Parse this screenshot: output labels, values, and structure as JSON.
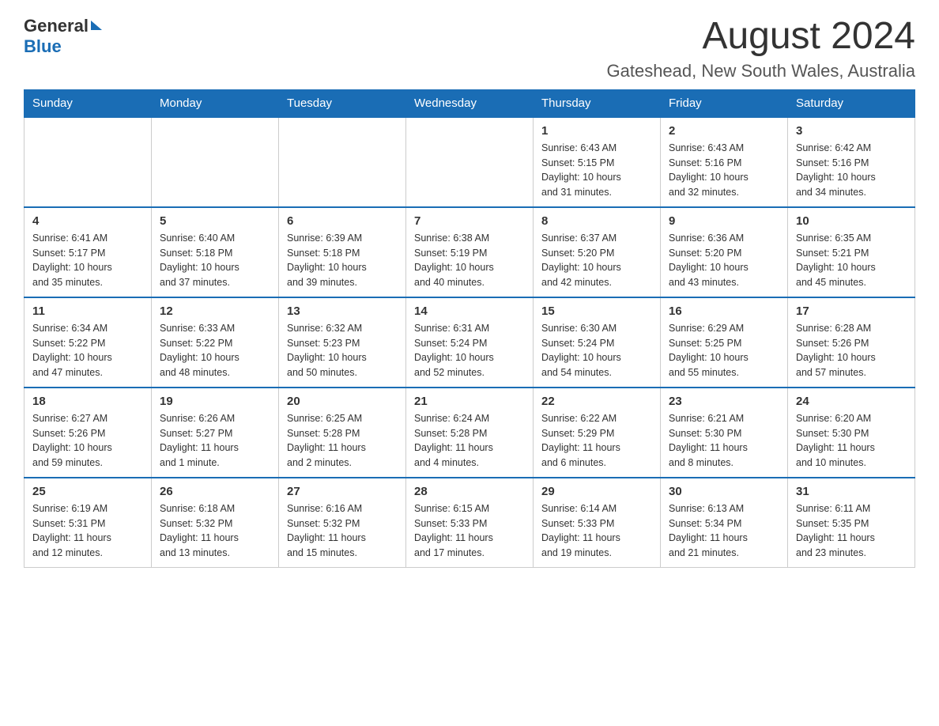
{
  "header": {
    "logo": {
      "general": "General",
      "blue": "Blue"
    },
    "title": "August 2024",
    "location": "Gateshead, New South Wales, Australia"
  },
  "calendar": {
    "weekdays": [
      "Sunday",
      "Monday",
      "Tuesday",
      "Wednesday",
      "Thursday",
      "Friday",
      "Saturday"
    ],
    "weeks": [
      [
        {
          "day": "",
          "info": ""
        },
        {
          "day": "",
          "info": ""
        },
        {
          "day": "",
          "info": ""
        },
        {
          "day": "",
          "info": ""
        },
        {
          "day": "1",
          "info": "Sunrise: 6:43 AM\nSunset: 5:15 PM\nDaylight: 10 hours\nand 31 minutes."
        },
        {
          "day": "2",
          "info": "Sunrise: 6:43 AM\nSunset: 5:16 PM\nDaylight: 10 hours\nand 32 minutes."
        },
        {
          "day": "3",
          "info": "Sunrise: 6:42 AM\nSunset: 5:16 PM\nDaylight: 10 hours\nand 34 minutes."
        }
      ],
      [
        {
          "day": "4",
          "info": "Sunrise: 6:41 AM\nSunset: 5:17 PM\nDaylight: 10 hours\nand 35 minutes."
        },
        {
          "day": "5",
          "info": "Sunrise: 6:40 AM\nSunset: 5:18 PM\nDaylight: 10 hours\nand 37 minutes."
        },
        {
          "day": "6",
          "info": "Sunrise: 6:39 AM\nSunset: 5:18 PM\nDaylight: 10 hours\nand 39 minutes."
        },
        {
          "day": "7",
          "info": "Sunrise: 6:38 AM\nSunset: 5:19 PM\nDaylight: 10 hours\nand 40 minutes."
        },
        {
          "day": "8",
          "info": "Sunrise: 6:37 AM\nSunset: 5:20 PM\nDaylight: 10 hours\nand 42 minutes."
        },
        {
          "day": "9",
          "info": "Sunrise: 6:36 AM\nSunset: 5:20 PM\nDaylight: 10 hours\nand 43 minutes."
        },
        {
          "day": "10",
          "info": "Sunrise: 6:35 AM\nSunset: 5:21 PM\nDaylight: 10 hours\nand 45 minutes."
        }
      ],
      [
        {
          "day": "11",
          "info": "Sunrise: 6:34 AM\nSunset: 5:22 PM\nDaylight: 10 hours\nand 47 minutes."
        },
        {
          "day": "12",
          "info": "Sunrise: 6:33 AM\nSunset: 5:22 PM\nDaylight: 10 hours\nand 48 minutes."
        },
        {
          "day": "13",
          "info": "Sunrise: 6:32 AM\nSunset: 5:23 PM\nDaylight: 10 hours\nand 50 minutes."
        },
        {
          "day": "14",
          "info": "Sunrise: 6:31 AM\nSunset: 5:24 PM\nDaylight: 10 hours\nand 52 minutes."
        },
        {
          "day": "15",
          "info": "Sunrise: 6:30 AM\nSunset: 5:24 PM\nDaylight: 10 hours\nand 54 minutes."
        },
        {
          "day": "16",
          "info": "Sunrise: 6:29 AM\nSunset: 5:25 PM\nDaylight: 10 hours\nand 55 minutes."
        },
        {
          "day": "17",
          "info": "Sunrise: 6:28 AM\nSunset: 5:26 PM\nDaylight: 10 hours\nand 57 minutes."
        }
      ],
      [
        {
          "day": "18",
          "info": "Sunrise: 6:27 AM\nSunset: 5:26 PM\nDaylight: 10 hours\nand 59 minutes."
        },
        {
          "day": "19",
          "info": "Sunrise: 6:26 AM\nSunset: 5:27 PM\nDaylight: 11 hours\nand 1 minute."
        },
        {
          "day": "20",
          "info": "Sunrise: 6:25 AM\nSunset: 5:28 PM\nDaylight: 11 hours\nand 2 minutes."
        },
        {
          "day": "21",
          "info": "Sunrise: 6:24 AM\nSunset: 5:28 PM\nDaylight: 11 hours\nand 4 minutes."
        },
        {
          "day": "22",
          "info": "Sunrise: 6:22 AM\nSunset: 5:29 PM\nDaylight: 11 hours\nand 6 minutes."
        },
        {
          "day": "23",
          "info": "Sunrise: 6:21 AM\nSunset: 5:30 PM\nDaylight: 11 hours\nand 8 minutes."
        },
        {
          "day": "24",
          "info": "Sunrise: 6:20 AM\nSunset: 5:30 PM\nDaylight: 11 hours\nand 10 minutes."
        }
      ],
      [
        {
          "day": "25",
          "info": "Sunrise: 6:19 AM\nSunset: 5:31 PM\nDaylight: 11 hours\nand 12 minutes."
        },
        {
          "day": "26",
          "info": "Sunrise: 6:18 AM\nSunset: 5:32 PM\nDaylight: 11 hours\nand 13 minutes."
        },
        {
          "day": "27",
          "info": "Sunrise: 6:16 AM\nSunset: 5:32 PM\nDaylight: 11 hours\nand 15 minutes."
        },
        {
          "day": "28",
          "info": "Sunrise: 6:15 AM\nSunset: 5:33 PM\nDaylight: 11 hours\nand 17 minutes."
        },
        {
          "day": "29",
          "info": "Sunrise: 6:14 AM\nSunset: 5:33 PM\nDaylight: 11 hours\nand 19 minutes."
        },
        {
          "day": "30",
          "info": "Sunrise: 6:13 AM\nSunset: 5:34 PM\nDaylight: 11 hours\nand 21 minutes."
        },
        {
          "day": "31",
          "info": "Sunrise: 6:11 AM\nSunset: 5:35 PM\nDaylight: 11 hours\nand 23 minutes."
        }
      ]
    ]
  }
}
